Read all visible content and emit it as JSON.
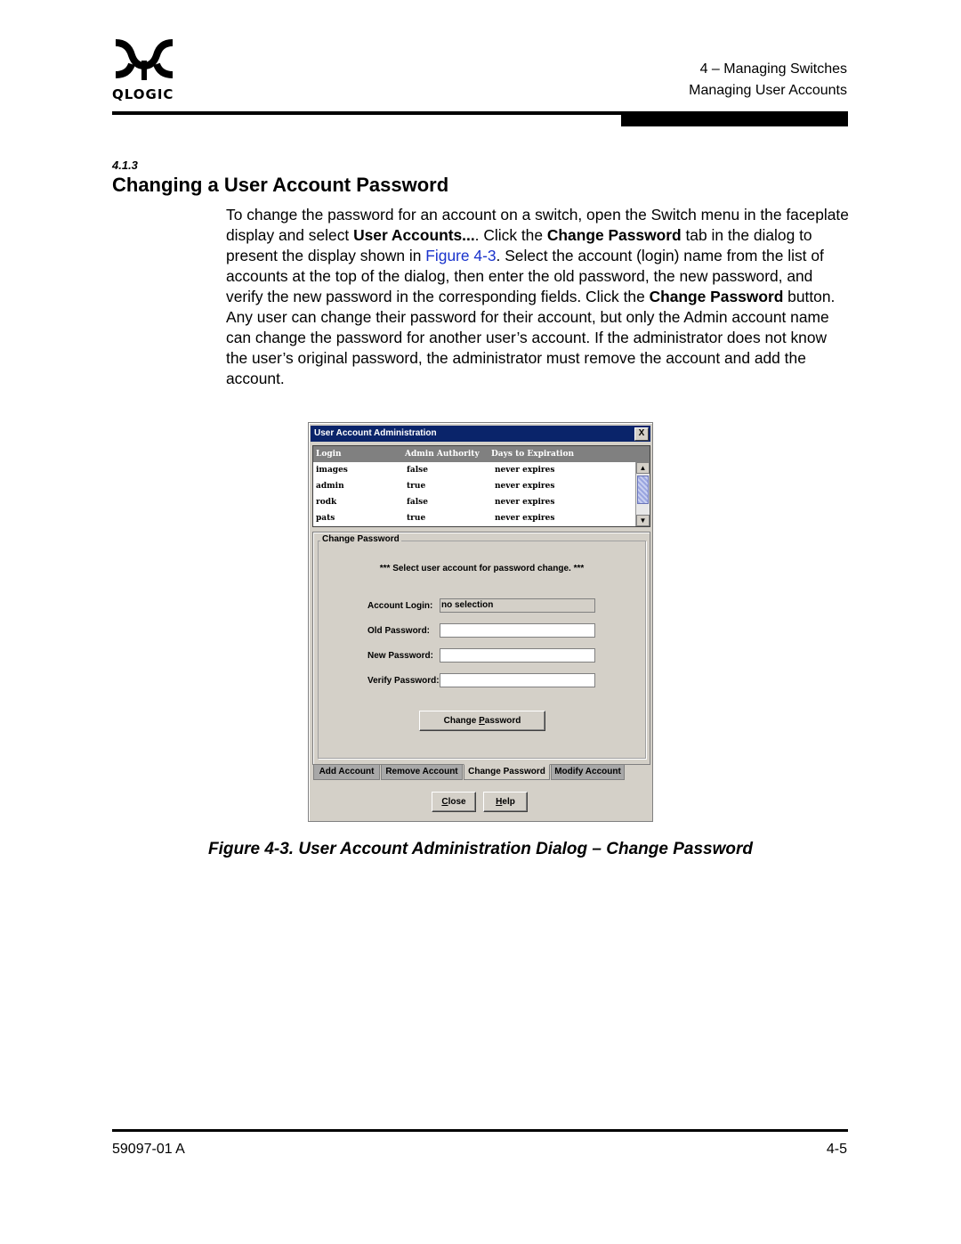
{
  "header": {
    "logo_text": "QLOGIC",
    "chapter": "4 – Managing Switches",
    "section": "Managing User Accounts"
  },
  "section": {
    "number": "4.1.3",
    "title": "Changing a User Account Password",
    "paragraph": {
      "p1": "To change the password for an account on a switch, open the Switch menu in the faceplate display and select ",
      "b1": "User Accounts...",
      "p2": ". Click the ",
      "b2": "Change Password",
      "p3": " tab in the dialog to present the display shown in ",
      "link": "Figure 4-3",
      "p4": ". Select the account (login) name from the list of accounts at the top of the dialog, then enter the old password, the new password, and verify the new password in the corresponding fields. Click the ",
      "b3": "Change Password",
      "p5": " button. Any user can change their password for their account, but only the Admin account name can change the password for another user’s account. If the administrator does not know the user’s original password, the administrator must remove the account and add the account."
    }
  },
  "dialog": {
    "title": "User Account Administration",
    "close_glyph": "X",
    "table": {
      "columns": [
        "Login",
        "Admin Authority",
        "Days to Expiration"
      ],
      "rows": [
        [
          "images",
          "false",
          "never expires"
        ],
        [
          "admin",
          "true",
          "never expires"
        ],
        [
          "rodk",
          "false",
          "never expires"
        ],
        [
          "pats",
          "true",
          "never expires"
        ]
      ]
    },
    "group_title": "Change Password",
    "prompt": "*** Select user account for password change. ***",
    "fields": {
      "account_login_label": "Account Login:",
      "account_login_value": "no selection",
      "old_password_label": "Old Password:",
      "old_password_value": "",
      "new_password_label": "New Password:",
      "new_password_value": "",
      "verify_password_label": "Verify Password:",
      "verify_password_value": ""
    },
    "change_button": {
      "pre": "Change ",
      "mn": "P",
      "post": "assword"
    },
    "tabs": [
      "Add Account",
      "Remove Account",
      "Change Password",
      "Modify Account"
    ],
    "active_tab": "Change Password",
    "close_button": {
      "mn": "C",
      "post": "lose"
    },
    "help_button": {
      "mn": "H",
      "post": "elp"
    }
  },
  "caption": "Figure 4-3.  User Account Administration Dialog – Change Password",
  "footer": {
    "doc_number": "59097-01 A",
    "page": "4-5"
  }
}
